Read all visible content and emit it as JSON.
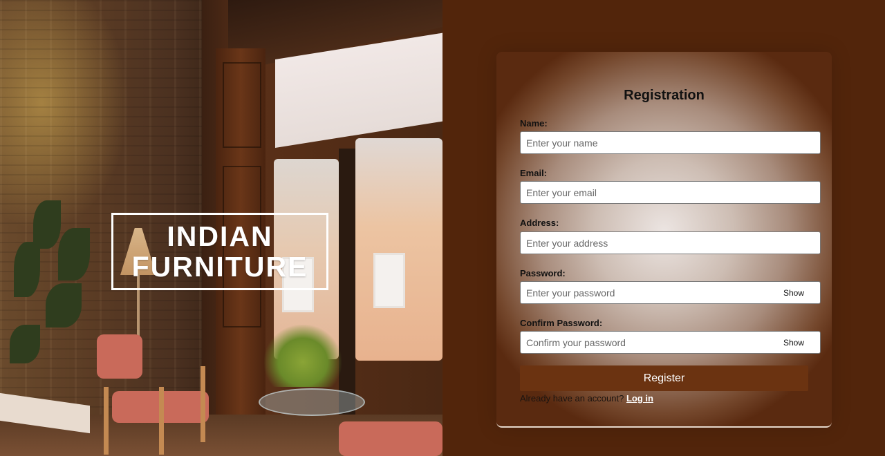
{
  "hero": {
    "title_line1": "INDIAN",
    "title_line2": "FURNITURE"
  },
  "form": {
    "title": "Registration",
    "fields": [
      {
        "label": "Name:",
        "placeholder": "Enter your name"
      },
      {
        "label": "Email:",
        "placeholder": "Enter your email"
      },
      {
        "label": "Address:",
        "placeholder": "Enter your address"
      },
      {
        "label": "Password:",
        "placeholder": "Enter your password",
        "toggle": "Show"
      },
      {
        "label": "Confirm Password:",
        "placeholder": "Confirm your password",
        "toggle": "Show"
      }
    ],
    "submit_label": "Register",
    "login_prompt": "Already have an account?",
    "login_link": "Log in"
  },
  "colors": {
    "page_bg": "#52250b",
    "button_bg": "#6b3311",
    "title_text": "#ffffff"
  }
}
